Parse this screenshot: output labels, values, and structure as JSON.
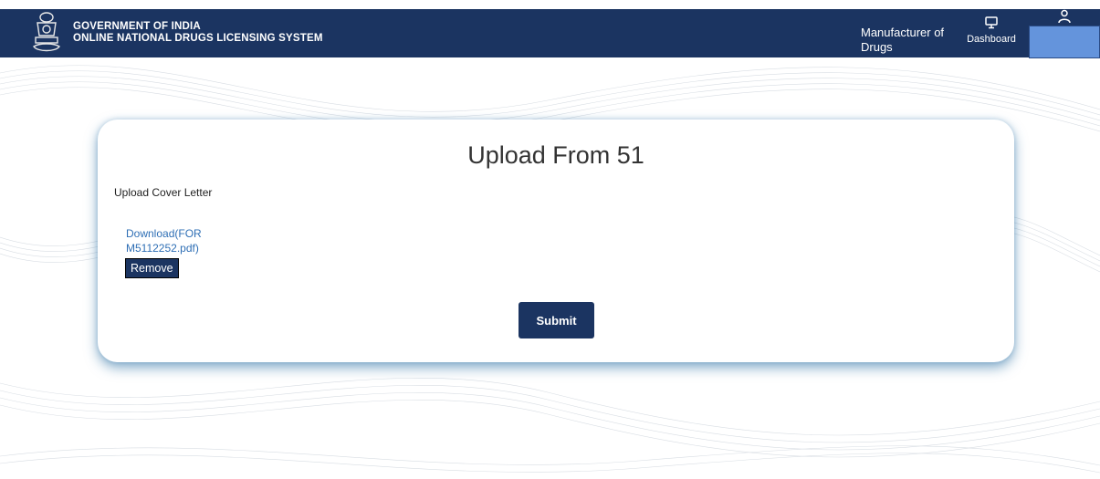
{
  "header": {
    "line1": "GOVERNMENT OF INDIA",
    "line2": "ONLINE NATIONAL DRUGS LICENSING SYSTEM",
    "role": "Manufacturer of Drugs",
    "dashboard_label": "Dashboard",
    "colors": {
      "navy": "#1b3461",
      "profile_box": "#6494dc"
    }
  },
  "form": {
    "title": "Upload From 51",
    "cover_letter_label": "Upload Cover Letter",
    "download_link_line1": "Download(FOR",
    "download_link_line2": "M5112252.pdf)",
    "remove_label": "Remove",
    "submit_label": "Submit"
  }
}
